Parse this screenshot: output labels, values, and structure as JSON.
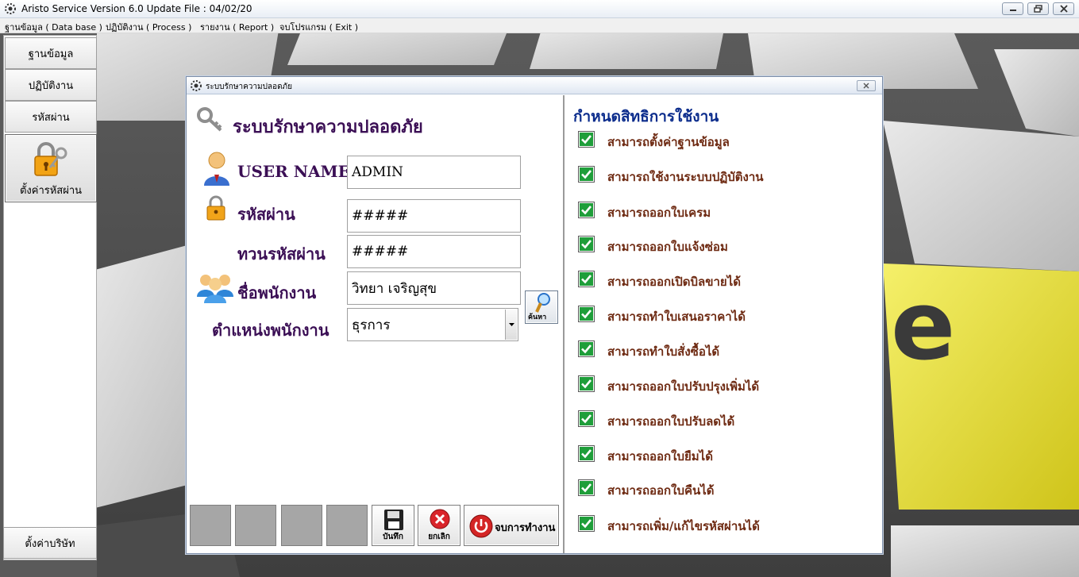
{
  "window": {
    "title": "Aristo Service Version 6.0 Update File : 04/02/20"
  },
  "menu": {
    "items": [
      {
        "label": "ฐานข้อมูล ( Data base )"
      },
      {
        "label": "ปฏิบัติงาน ( Process )"
      },
      {
        "label": "รายงาน ( Report )"
      },
      {
        "label": "จบโปรแกรม ( Exit )"
      }
    ]
  },
  "sidebar": {
    "items": [
      {
        "label": "ฐานข้อมูล"
      },
      {
        "label": "ปฏิบัติงาน"
      },
      {
        "label": "รหัสผ่าน"
      },
      {
        "label": "ตั้งค่ารหัสผ่าน",
        "active": true
      }
    ],
    "bottom_label": "ตั้งค่าบริษัท"
  },
  "dialog": {
    "title": "ระบบรักษาความปลอดภัย",
    "section_title": "ระบบรักษาความปลอดภัย",
    "fields": {
      "username_label": "USER NAME",
      "username_value": "ADMIN",
      "password_label": "รหัสผ่าน",
      "password_value": "#####",
      "confirm_label": "ทวนรหัสผ่าน",
      "confirm_value": "#####",
      "employee_label": "ชื่อพนักงาน",
      "employee_value": "วิทยา เจริญสุข",
      "position_label": "ตำแหน่งพนักงาน",
      "position_value": "ธุรการ"
    },
    "search_button_label": "ค้นหา",
    "buttons": {
      "save": "บันทึก",
      "cancel": "ยกเลิก",
      "exit": "จบการทำงาน"
    },
    "permissions": {
      "heading": "กำหนดสิทธิการใช้งาน",
      "items": [
        {
          "label": "สามารถตั้งค่าฐานข้อมูล",
          "checked": true
        },
        {
          "label": "สามารถใช้งานระบบปฏิบัติงาน",
          "checked": true
        },
        {
          "label": "สามารถออกใบเครม",
          "checked": true
        },
        {
          "label": "สามารถออกใบแจ้งซ่อม",
          "checked": true
        },
        {
          "label": "สามารถออกเปิดบิลขายได้",
          "checked": true
        },
        {
          "label": "สามารถทำใบเสนอราคาได้",
          "checked": true
        },
        {
          "label": "สามารถทำใบสั่งซื้อได้",
          "checked": true
        },
        {
          "label": "สามารถออกใบปรับปรุงเพิ่มได้",
          "checked": true
        },
        {
          "label": "สามารถออกใบปรับลดได้",
          "checked": true
        },
        {
          "label": "สามารถออกใบยืมได้",
          "checked": true
        },
        {
          "label": "สามารถออกใบคืนได้",
          "checked": true
        },
        {
          "label": "สามารถเพิ่ม/แก้ไขรหัสผ่านได้",
          "checked": true
        }
      ]
    }
  },
  "colors": {
    "label_purple": "#3b0f55",
    "heading_blue": "#0b2c8c",
    "permission_brown": "#6e2a12",
    "check_green": "#1f9e3a"
  }
}
